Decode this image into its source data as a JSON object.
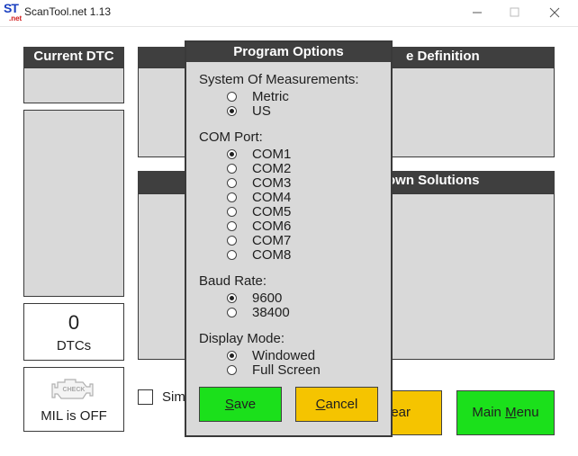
{
  "window": {
    "logo_st": "ST",
    "logo_net": ".net",
    "title": "ScanTool.net 1.13"
  },
  "main": {
    "current_dtc_header": "Current DTC",
    "definition_header": "e Definition",
    "solutions_header": "own Solutions",
    "dtc_count": "0",
    "dtc_count_label": "DTCs",
    "mil_check_text": "CHECK",
    "mil_status": "MIL is OFF",
    "checkbox_label_partial": "Sim",
    "clear_button_partial": "ear",
    "main_menu_button": {
      "prefix": "Main ",
      "mnemonic": "M",
      "rest": "enu"
    }
  },
  "dialog": {
    "title": "Program Options",
    "measurement_label": "System Of Measurements:",
    "measurement_options": [
      {
        "label": "Metric",
        "selected": false
      },
      {
        "label": "US",
        "selected": true
      }
    ],
    "com_label": "COM Port:",
    "com_options": [
      {
        "label": "COM1",
        "selected": true
      },
      {
        "label": "COM2",
        "selected": false
      },
      {
        "label": "COM3",
        "selected": false
      },
      {
        "label": "COM4",
        "selected": false
      },
      {
        "label": "COM5",
        "selected": false
      },
      {
        "label": "COM6",
        "selected": false
      },
      {
        "label": "COM7",
        "selected": false
      },
      {
        "label": "COM8",
        "selected": false
      }
    ],
    "baud_label": "Baud Rate:",
    "baud_options": [
      {
        "label": "9600",
        "selected": true
      },
      {
        "label": "38400",
        "selected": false
      }
    ],
    "display_label": "Display Mode:",
    "display_options": [
      {
        "label": "Windowed",
        "selected": true
      },
      {
        "label": "Full Screen",
        "selected": false
      }
    ],
    "save_button": {
      "mnemonic": "S",
      "rest": "ave"
    },
    "cancel_button": {
      "mnemonic": "C",
      "rest": "ancel"
    }
  },
  "colors": {
    "header_bg": "#3f3f3f",
    "panel_bg": "#d9d9d9",
    "green_button": "#1be01b",
    "yellow_button": "#f5c400"
  }
}
